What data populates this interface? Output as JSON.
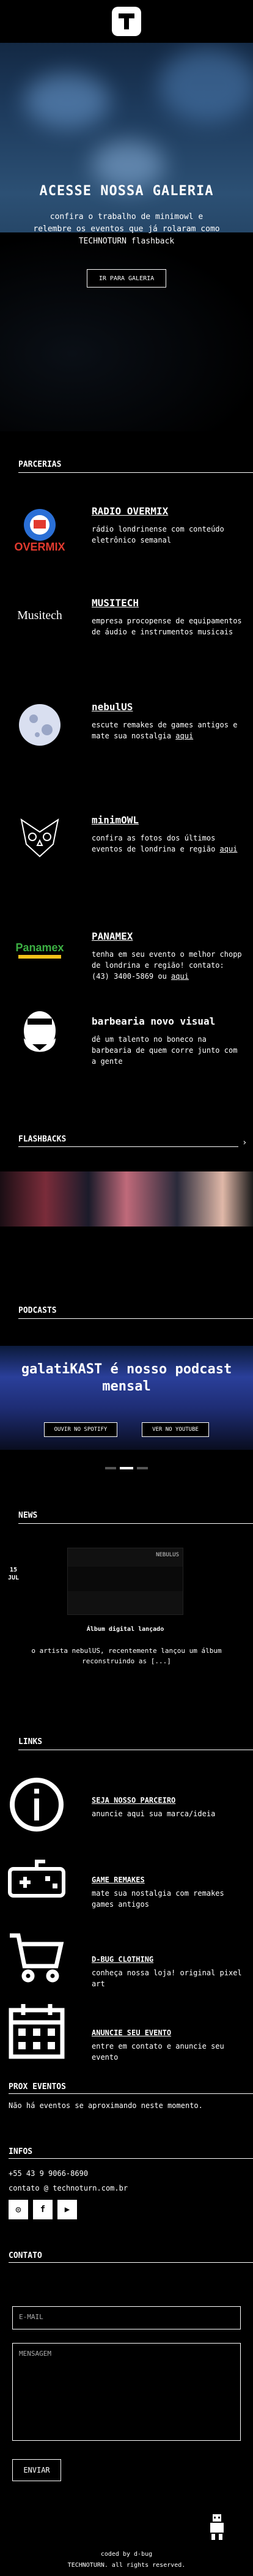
{
  "hero": {
    "title": "ACESSE NOSSA GALERIA",
    "text": "confira o trabalho de minimowl e relembre os eventos que já rolaram como TECHNOTURN flashback",
    "button": "IR PARA GALERIA"
  },
  "partners": {
    "heading": "PARCERIAS",
    "items": [
      {
        "name": "RADIO OVERMIX",
        "text": "rádio londrinense com conteúdo eletrônico semanal",
        "icon": "overmix-logo"
      },
      {
        "name": "MUSITECH",
        "text": "empresa procopense de equipamentos de áudio e instrumentos musicais",
        "icon": "musitech-logo"
      },
      {
        "name": "nebulUS",
        "text": "escute remakes de games antigos e mate sua nostalgia ",
        "link": "aqui",
        "icon": "nebulus-logo"
      },
      {
        "name": "minimOWL",
        "text": "confira as fotos dos últimos eventos de londrina e região ",
        "link": "aqui",
        "icon": "owl-logo"
      },
      {
        "name": "PANAMEX",
        "text": "tenha em seu evento o melhor chopp de londrina e região! contato: (43) 3400-5869 ou ",
        "link": "aqui",
        "icon": "panamex-logo"
      },
      {
        "name": "barbearia novo visual",
        "text": "dê um talento no boneco na barbearia de quem corre junto com a gente",
        "icon": "barber-logo"
      }
    ]
  },
  "flashbacks": {
    "heading": "FLASHBACKS"
  },
  "podcasts": {
    "heading": "PODCASTS",
    "title": "galatiKAST é nosso podcast mensal",
    "btn_spotify": "OUVIR NO SPOTIFY",
    "btn_youtube": "VER NO YOUTUBE"
  },
  "news": {
    "heading": "NEWS",
    "date_day": "15",
    "date_month": "JUL",
    "card_tag": "NEBULUS",
    "title": "Álbum digital lançado",
    "text": "o artista nebulUS, recentemente lançou um álbum reconstruindo as [...]"
  },
  "links": {
    "heading": "LINKS",
    "items": [
      {
        "title": "SEJA NOSSO PARCEIRO",
        "text": "anuncie aqui sua marca/ideia",
        "icon": "info-icon"
      },
      {
        "title": "GAME REMAKES",
        "text": "mate sua nostalgia com remakes games antigos",
        "icon": "gamepad-icon"
      },
      {
        "title": "D-BUG CLOTHING",
        "text": "conheça nossa loja! original pixel art",
        "icon": "cart-icon"
      },
      {
        "title": "ANUNCIE SEU EVENTO",
        "text": "entre em contato e anuncie seu evento",
        "icon": "calendar-icon"
      }
    ]
  },
  "events": {
    "heading": "PROX EVENTOS",
    "text": "Não há eventos se aproximando neste momento."
  },
  "infos": {
    "heading": "INFOS",
    "phone": "+55 43 9 9066-8690",
    "email": "contato @ technoturn.com.br"
  },
  "contact": {
    "heading": "CONTATO",
    "email_placeholder": "E-MAIL",
    "message_placeholder": "MENSAGEM",
    "send": "ENVIAR"
  },
  "footer": {
    "coded": "coded by d-bug",
    "rights": "TECHNOTURN. all rights reserved."
  },
  "colors": {
    "bg": "#000000",
    "fg": "#ffffff",
    "accent_blue": "#2c5074"
  }
}
